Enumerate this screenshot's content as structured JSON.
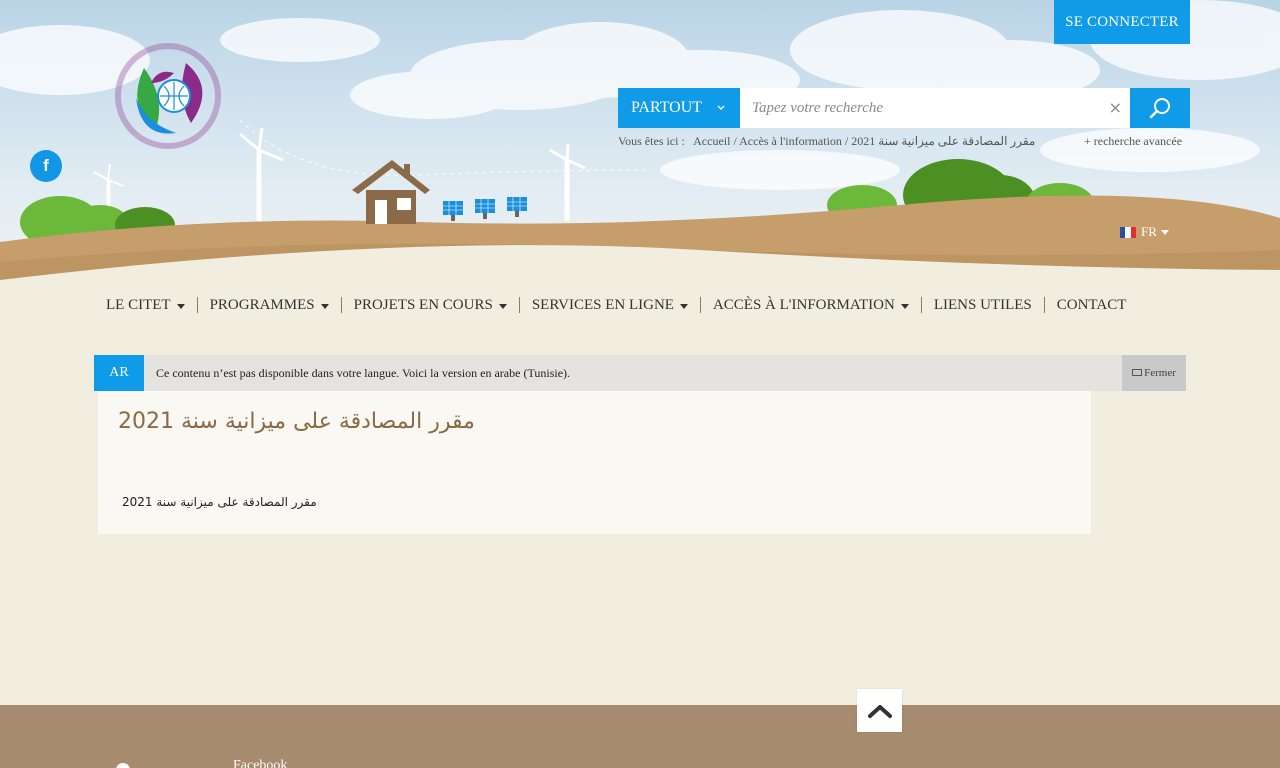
{
  "header": {
    "login_label": "SE CONNECTER",
    "search": {
      "scope_label": "PARTOUT",
      "placeholder": "Tapez votre recherche",
      "clear_symbol": "×"
    },
    "breadcrumb": {
      "prefix": "Vous êtes ici :",
      "items": [
        "Accueil",
        "Accès à l'information",
        "مقرر المصادقة على ميزانية سنة 2021"
      ],
      "separator": "/"
    },
    "advanced_search": "+   recherche avancée",
    "social_icon": "facebook-icon",
    "social_letter": "f",
    "language": {
      "current": "FR",
      "flag_colors": [
        "#2b4ea2",
        "#ffffff",
        "#e2302f"
      ]
    },
    "logo_icon": "citet-logo-icon"
  },
  "nav": {
    "items": [
      {
        "label": "LE CITET",
        "dropdown": true
      },
      {
        "label": "PROGRAMMES",
        "dropdown": true
      },
      {
        "label": "PROJETS EN COURS",
        "dropdown": true
      },
      {
        "label": "SERVICES EN LIGNE",
        "dropdown": true
      },
      {
        "label": "ACCÈS À L'INFORMATION",
        "dropdown": true
      },
      {
        "label": "LIENS UTILES",
        "dropdown": false
      },
      {
        "label": "CONTACT",
        "dropdown": false
      }
    ]
  },
  "notice": {
    "lang": "AR",
    "text": "Ce contenu n’est pas disponible dans votre langue. Voici la version en arabe (Tunisie).",
    "close_label": "Fermer"
  },
  "content": {
    "title": "مقرر المصادقة على ميزانية سنة 2021",
    "body": "مقرر المصادقة على ميزانية سنة 2021"
  },
  "footer": {
    "facebook_label": "Facebook"
  },
  "colors": {
    "accent": "#0f9be8",
    "page_bg": "#f1eedf",
    "footer_bg": "#a68b6e",
    "title": "#8a6a45"
  }
}
